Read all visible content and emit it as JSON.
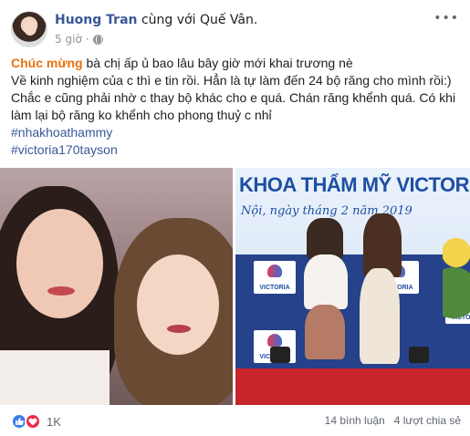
{
  "header": {
    "author": "Huong Tran",
    "with_text": "cùng với",
    "tagged": "Quế Vân.",
    "time": "5 giờ",
    "more": "•••"
  },
  "post": {
    "celebrate": "Chúc mừng",
    "line1_rest": " bà chị ấp ủ bao lâu bây giờ mới khai trương nè",
    "line2": "Về kinh nghiệm của c thì e tin rồi. Hẳn là tự làm đến 24 bộ răng cho mình rồi:)",
    "line3": "Chắc e cũng phải nhờ c thay bộ khác cho e quá. Chán răng khểnh quá. Có khi làm lại bộ răng ko khểnh cho phong thuỷ c nhỉ",
    "hashtags": [
      "#nhakhoathammy",
      "#victoria170tayson"
    ]
  },
  "photo_right": {
    "banner": "KHOA THẨM MỸ VICTORIA",
    "date": "Nội, ngày         tháng 2 năm 2019",
    "logo_label": "VICTORIA"
  },
  "footer": {
    "reactions": "1K",
    "comments": "14 bình luận",
    "shares": "4 lượt chia sẻ"
  },
  "colors": {
    "link": "#385898",
    "celebrate": "#e9710f",
    "like": "#3b7cf0",
    "love": "#f0284a"
  }
}
